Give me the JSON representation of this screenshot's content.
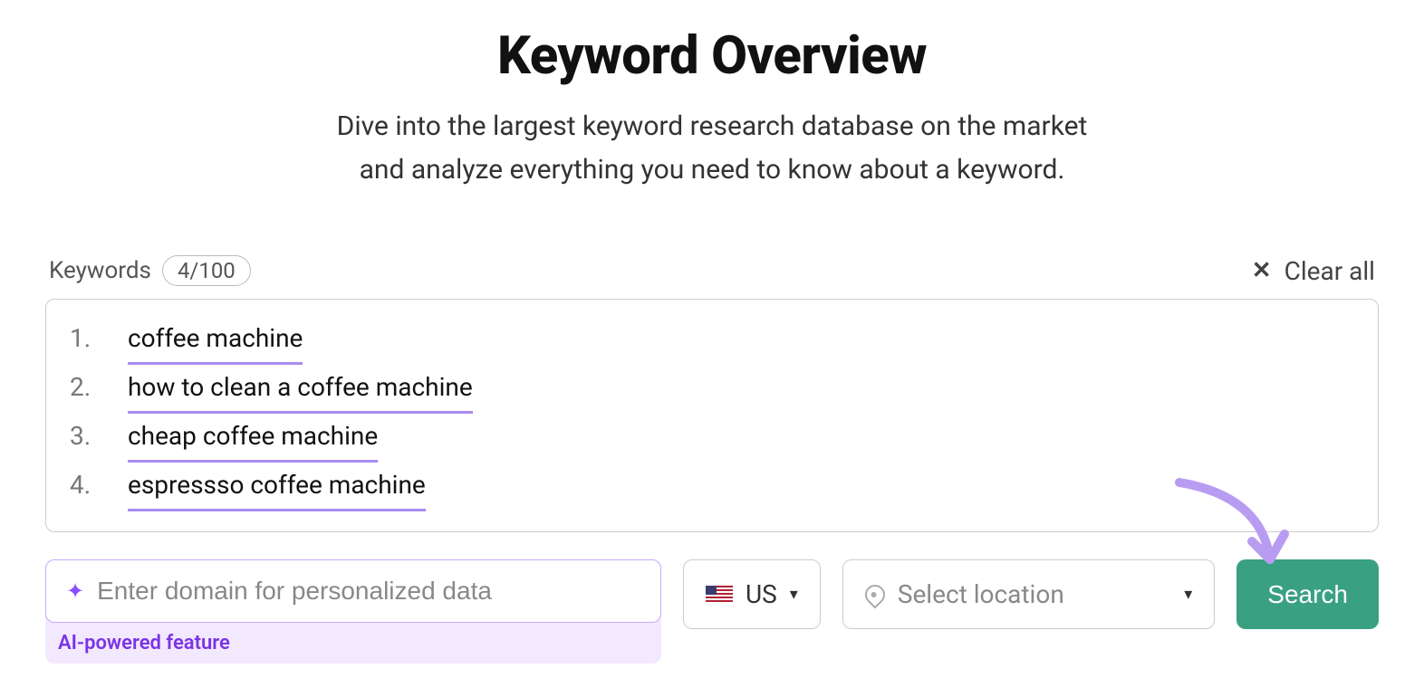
{
  "title": "Keyword Overview",
  "subtitle_line1": "Dive into the largest keyword research database on the market",
  "subtitle_line2": "and analyze everything you need to know about a keyword.",
  "keywords": {
    "label": "Keywords",
    "count_text": "4/100",
    "clear_label": "Clear all",
    "items": [
      "coffee machine",
      "how to clean a coffee machine",
      "cheap coffee machine",
      "espressso coffee machine"
    ]
  },
  "domain": {
    "placeholder": "Enter domain for personalized data",
    "ai_label": "AI-powered feature"
  },
  "country": {
    "code": "US"
  },
  "location": {
    "placeholder": "Select location"
  },
  "search_label": "Search",
  "colors": {
    "accent_purple": "#a88cf0",
    "button_green": "#3aa082",
    "ai_bg": "#f3e9ff"
  }
}
